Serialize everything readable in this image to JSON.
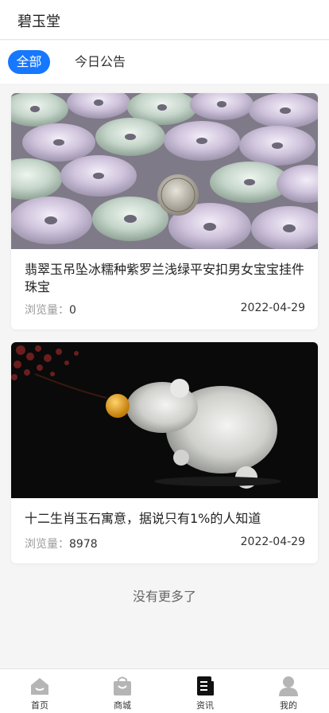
{
  "header": {
    "title": "碧玉堂"
  },
  "tabs": [
    {
      "label": "全部",
      "active": true
    },
    {
      "label": "今日公告",
      "active": false
    }
  ],
  "articles": [
    {
      "title": "翡翠玉吊坠冰糯种紫罗兰浅绿平安扣男女宝宝挂件珠宝",
      "views_label": "浏览量：",
      "views": "0",
      "date": "2022-04-29",
      "image": "jade-donut-pendants-photo"
    },
    {
      "title": "十二生肖玉石寓意，据说只有1%的人知道",
      "views_label": "浏览量：",
      "views": "8978",
      "date": "2022-04-29",
      "image": "jade-rat-carving-photo"
    }
  ],
  "footer_text": "没有更多了",
  "bottom_nav": [
    {
      "label": "首页",
      "icon": "home-icon",
      "active": false
    },
    {
      "label": "商城",
      "icon": "shopping-bag-icon",
      "active": false
    },
    {
      "label": "资讯",
      "icon": "news-icon",
      "active": true
    },
    {
      "label": "我的",
      "icon": "user-icon",
      "active": false
    }
  ],
  "colors": {
    "accent": "#1677ff",
    "inactive_icon": "#b5b5b5",
    "active_icon": "#111111"
  }
}
